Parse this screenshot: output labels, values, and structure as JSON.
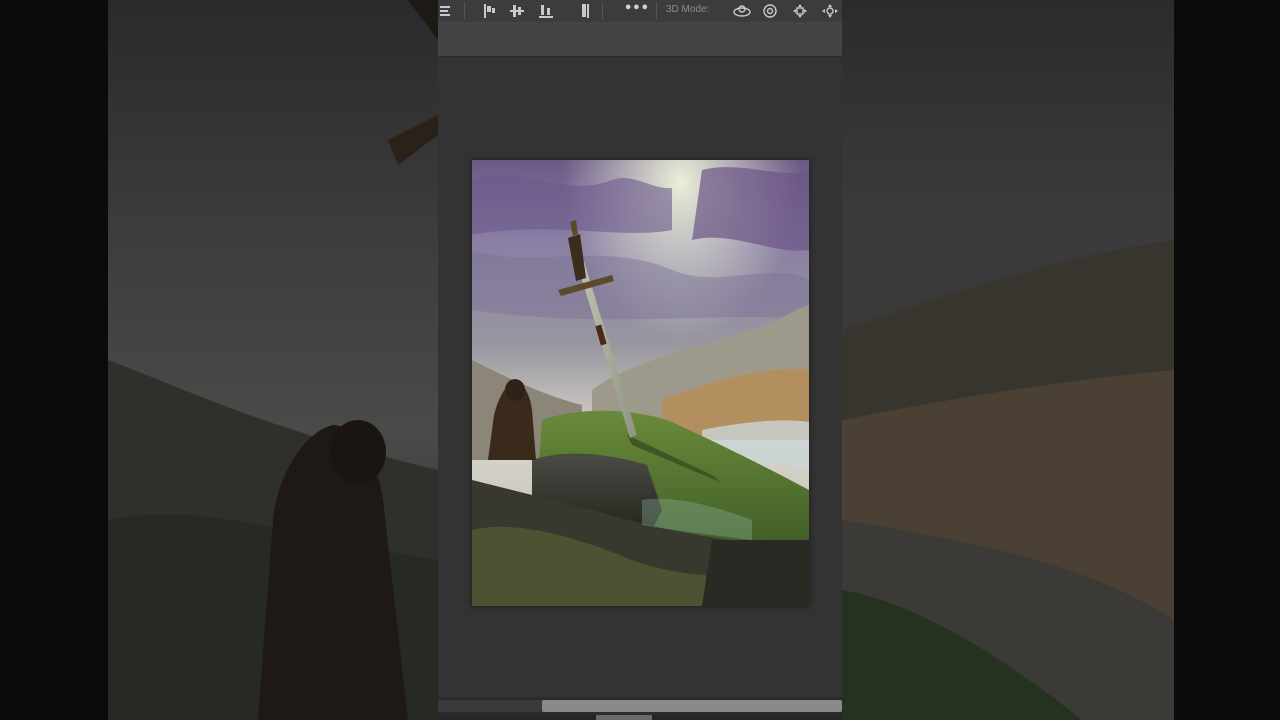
{
  "options_bar": {
    "more_label": "•••",
    "mode_label": "3D Mode:",
    "icons": [
      "align-horizontal-centers-icon",
      "align-left-edges-icon",
      "align-vertical-centers-icon",
      "align-bottom-edges-icon",
      "distribute-icon",
      "more-options-icon",
      "orbit-3d-icon",
      "roll-3d-icon",
      "pan-3d-icon",
      "slide-3d-icon"
    ]
  },
  "colors": {
    "panel_bg": "#323232",
    "options_bar_bg": "#3c3c3c",
    "tab_strip_bg": "#444444",
    "icon_color": "#c9c9c9",
    "mode_label_color": "#8c8c8c"
  },
  "document": {
    "artwork": "sword-in-hill-fantasy-scene"
  }
}
